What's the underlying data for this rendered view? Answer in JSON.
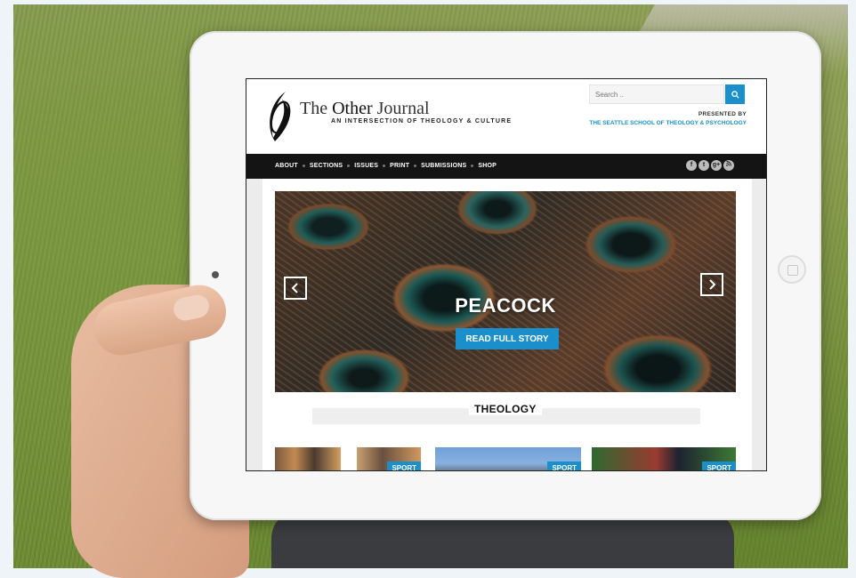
{
  "header": {
    "brand_title_a": "The ",
    "brand_title_b": "Other",
    "brand_title_c": " Journal",
    "brand_subtitle": "AN INTERSECTION OF THEOLOGY & CULTURE",
    "search_placeholder": "Search ..",
    "presented_by": "PRESENTED BY",
    "school_link": "THE SEATTLE SCHOOL OF THEOLOGY & PSYCHOLOGY"
  },
  "nav": {
    "items": [
      "ABOUT",
      "SECTIONS",
      "ISSUES",
      "PRINT",
      "SUBMISSIONS",
      "SHOP"
    ],
    "social": [
      "f",
      "t",
      "g+",
      "rss"
    ]
  },
  "slider": {
    "title": "PEACOCK",
    "cta": "READ FULL STORY"
  },
  "section": {
    "title": "THEOLOGY"
  },
  "thumbs": {
    "tag": "SPORT"
  },
  "colors": {
    "accent": "#1b8fcb",
    "nav_bg": "#141414"
  }
}
